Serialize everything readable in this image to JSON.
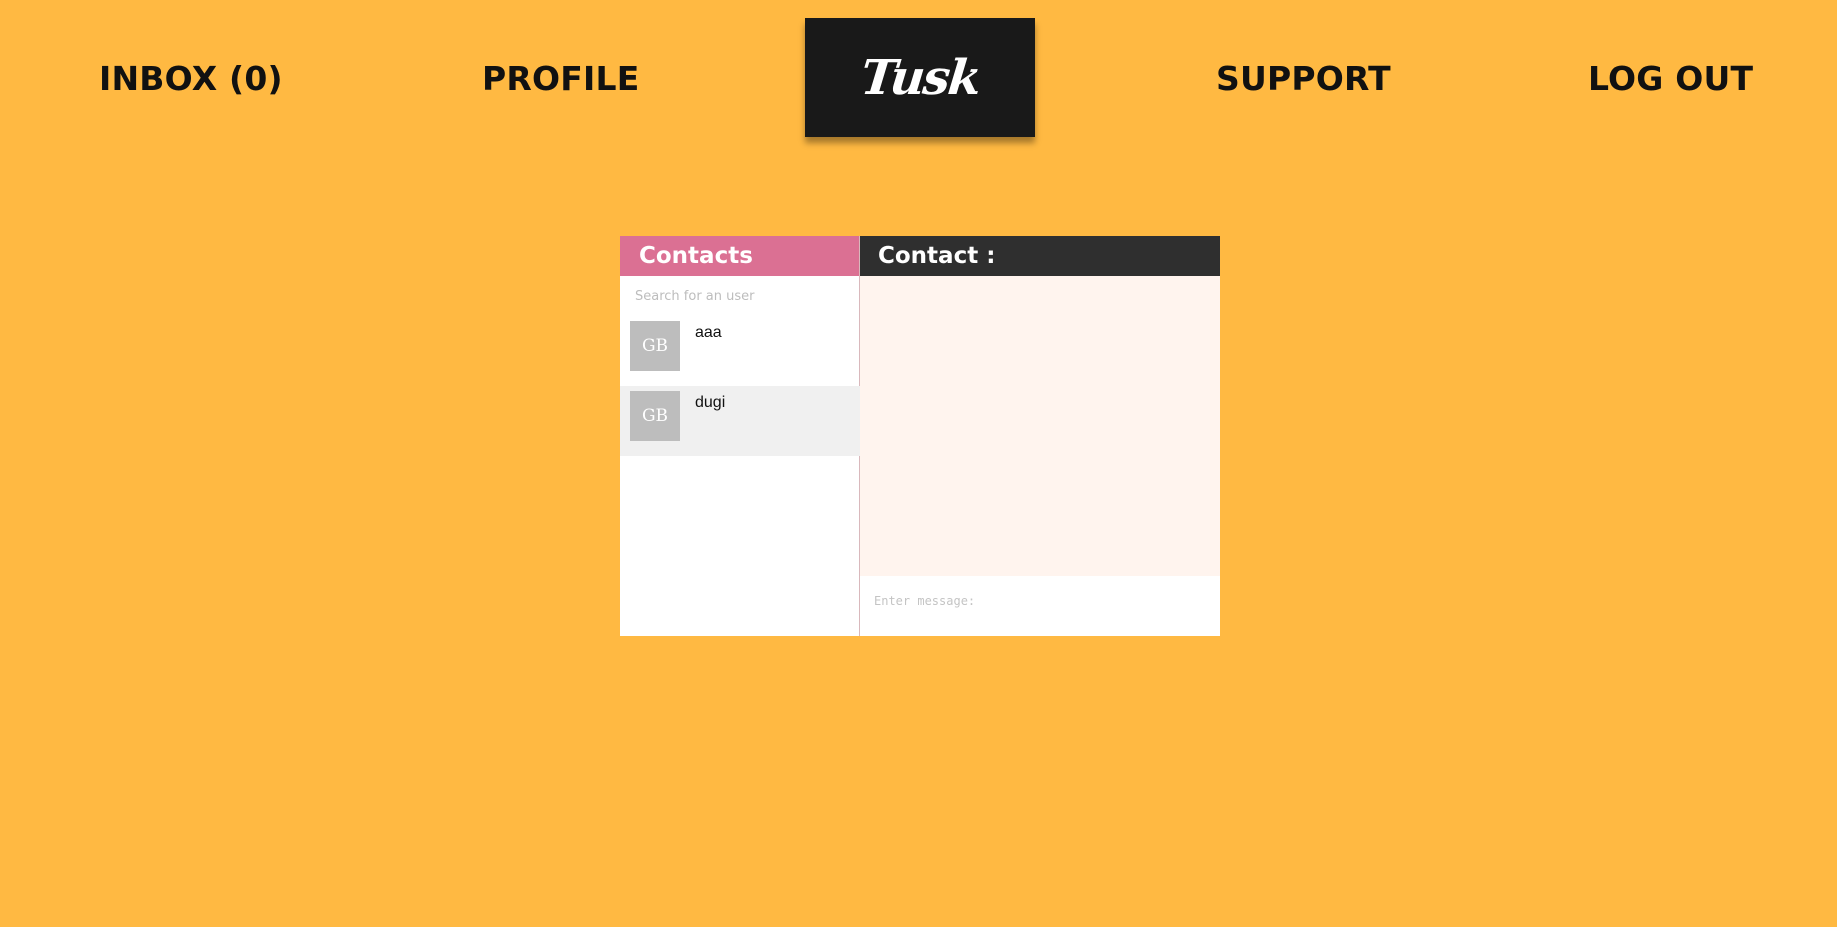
{
  "nav": {
    "inbox": "INBOX (0)",
    "profile": "PROFILE",
    "logo": "Tusk",
    "support": "SUPPORT",
    "logout": "LOG OUT"
  },
  "contacts": {
    "header": "Contacts",
    "search_placeholder": "Search for an user",
    "items": [
      {
        "initials": "GB",
        "name": "aaa"
      },
      {
        "initials": "GB",
        "name": "dugi"
      }
    ]
  },
  "conversation": {
    "header": "Contact :",
    "message_placeholder": "Enter message:"
  },
  "colors": {
    "background": "#FFB942",
    "contacts_header": "#DB7093",
    "conversation_header": "#2F2F2F",
    "logo_box": "#191919",
    "messages_area": "#FFF4EE"
  }
}
